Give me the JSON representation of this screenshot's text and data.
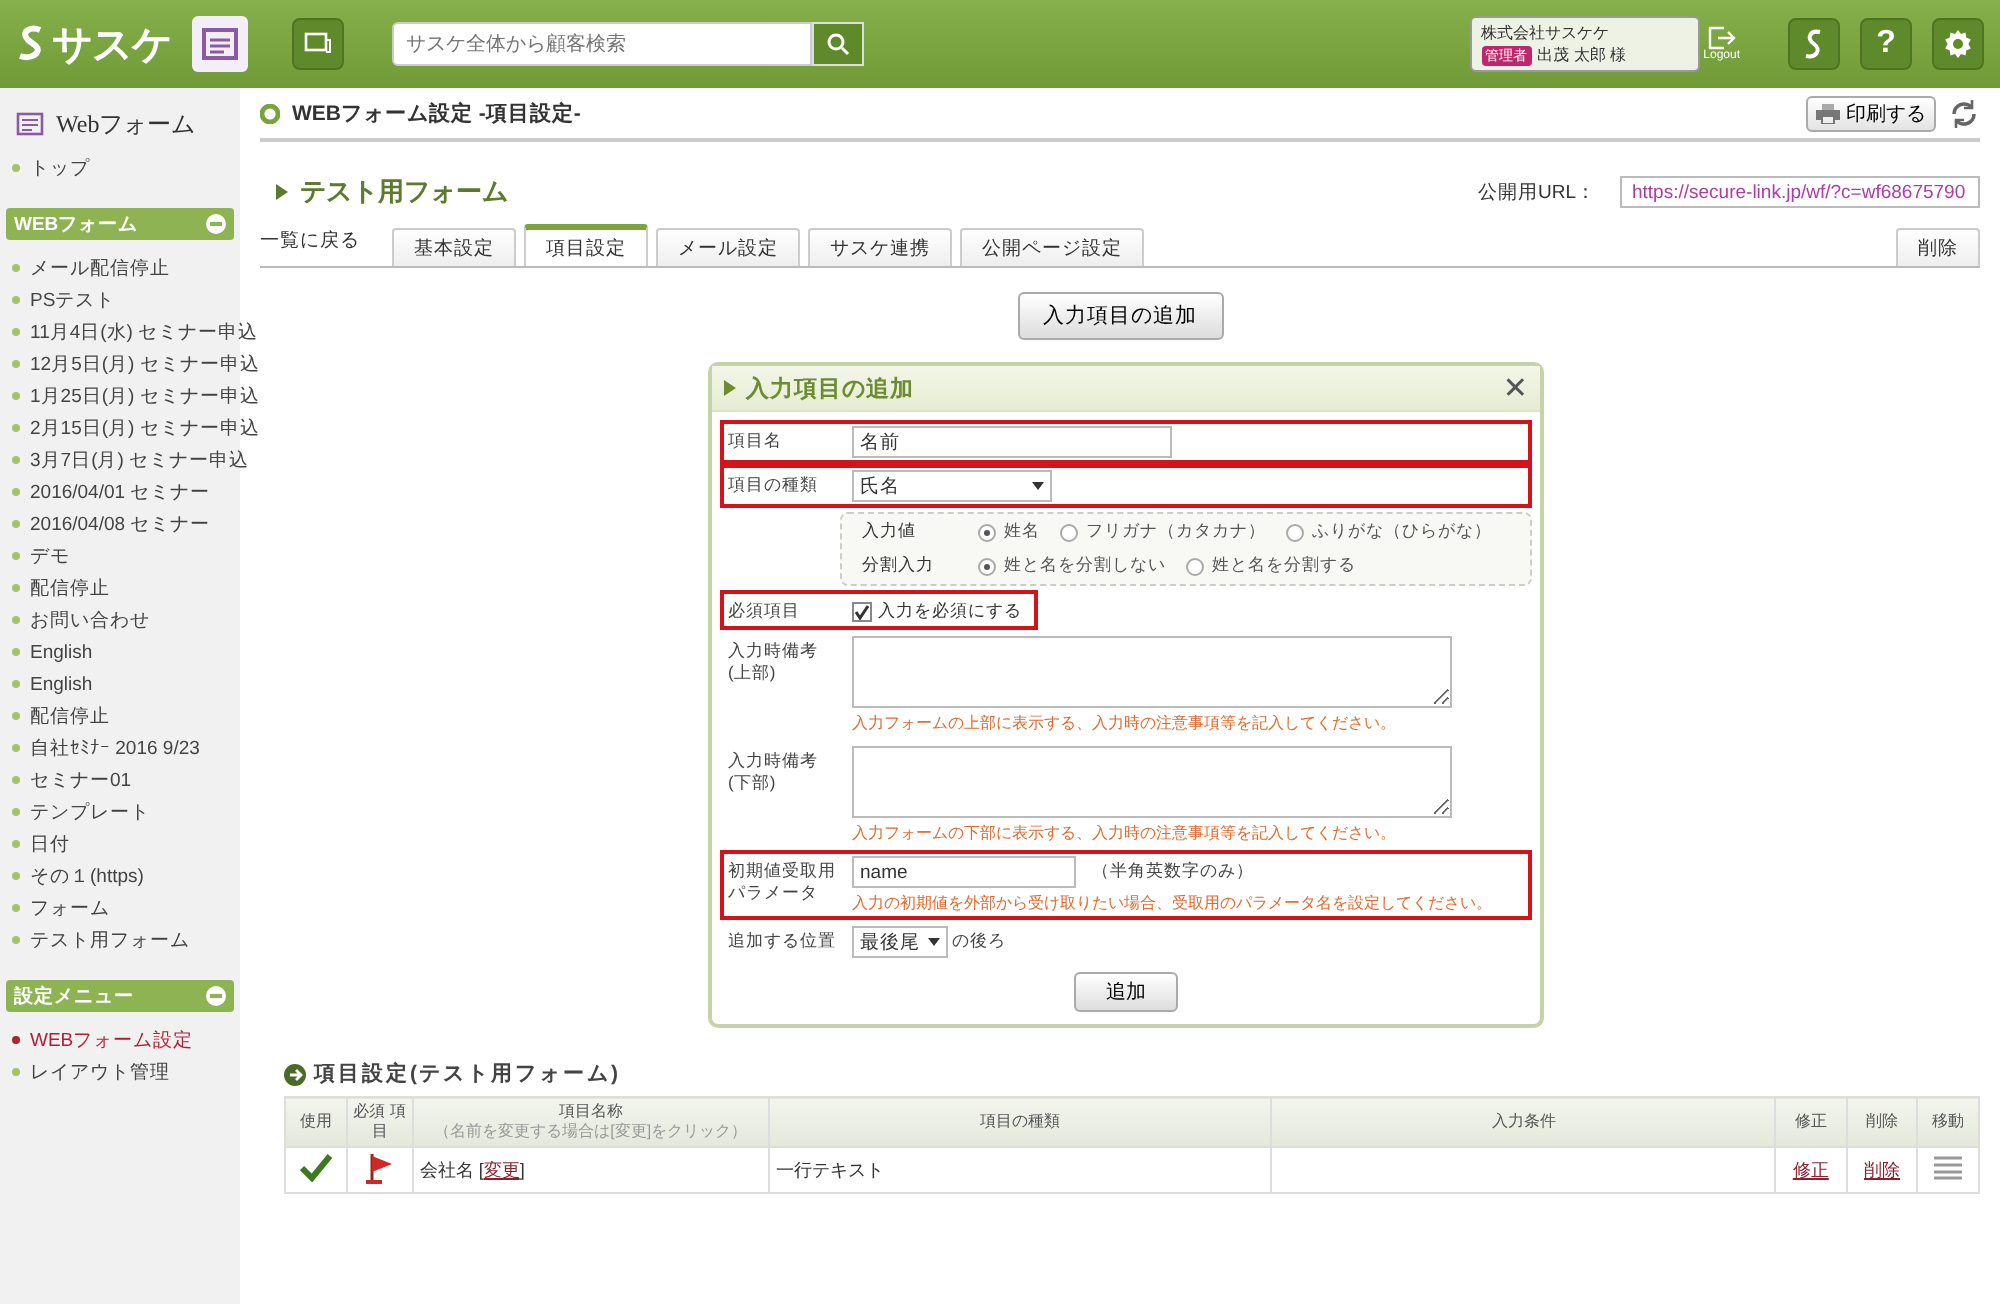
{
  "header": {
    "logo": "サスケ",
    "search_placeholder": "サスケ全体から顧客検索",
    "company": "株式会社サスケケ",
    "role_badge": "管理者",
    "user": "出茂 太郎 様",
    "logout": "Logout",
    "help": "?"
  },
  "sidebar": {
    "title": "Webフォーム",
    "top_link": "トップ",
    "sections": [
      {
        "title": "WEBフォーム",
        "items": [
          {
            "label": "メール配信停止",
            "selected": false
          },
          {
            "label": "PSテスト",
            "selected": false
          },
          {
            "label": "11月4日(水) セミナー申込",
            "selected": false
          },
          {
            "label": "12月5日(月) セミナー申込",
            "selected": false
          },
          {
            "label": "1月25日(月) セミナー申込",
            "selected": false
          },
          {
            "label": "2月15日(月) セミナー申込",
            "selected": false
          },
          {
            "label": "3月7日(月) セミナー申込",
            "selected": false
          },
          {
            "label": "2016/04/01 セミナー",
            "selected": false
          },
          {
            "label": "2016/04/08 セミナー",
            "selected": false
          },
          {
            "label": "デモ",
            "selected": false
          },
          {
            "label": "配信停止",
            "selected": false
          },
          {
            "label": "お問い合わせ",
            "selected": false
          },
          {
            "label": "English",
            "selected": false
          },
          {
            "label": "English",
            "selected": false
          },
          {
            "label": "配信停止",
            "selected": false
          },
          {
            "label": "自社ｾﾐﾅｰ 2016 9/23",
            "selected": false
          },
          {
            "label": "セミナー01",
            "selected": false
          },
          {
            "label": "テンプレート",
            "selected": false
          },
          {
            "label": "日付",
            "selected": false
          },
          {
            "label": "その１(https)",
            "selected": false
          },
          {
            "label": "フォーム",
            "selected": false
          },
          {
            "label": "テスト用フォーム",
            "selected": false
          }
        ]
      },
      {
        "title": "設定メニュー",
        "items": [
          {
            "label": "WEBフォーム設定",
            "selected": true
          },
          {
            "label": "レイアウト管理",
            "selected": false
          }
        ]
      }
    ]
  },
  "main": {
    "page_title": "WEBフォーム設定 -項目設定-",
    "print_button": "印刷する",
    "form_title": "テスト用フォーム",
    "url_label": "公開用URL：",
    "url_value": "https://secure-link.jp/wf/?c=wf68675790",
    "back_link": "一覧に戻る",
    "tabs": [
      {
        "label": "基本設定",
        "selected": false
      },
      {
        "label": "項目設定",
        "selected": true
      },
      {
        "label": "メール設定",
        "selected": false
      },
      {
        "label": "サスケ連携",
        "selected": false
      },
      {
        "label": "公開ページ設定",
        "selected": false
      }
    ],
    "delete_tab": "削除",
    "add_button": "入力項目の追加"
  },
  "dialog": {
    "title": "入力項目の追加",
    "fields": [
      {
        "kind": "text",
        "label": "項目名",
        "value": "名前",
        "highlighted": true
      },
      {
        "kind": "select",
        "label": "項目の種類",
        "value": "氏名",
        "highlighted": true
      },
      {
        "kind": "radios",
        "groups": [
          {
            "label": "入力値",
            "options": [
              {
                "label": "姓名",
                "selected": true
              },
              {
                "label": "フリガナ（カタカナ）",
                "selected": false
              },
              {
                "label": "ふりがな（ひらがな）",
                "selected": false
              }
            ]
          },
          {
            "label": "分割入力",
            "options": [
              {
                "label": "姓と名を分割しない",
                "selected": true
              },
              {
                "label": "姓と名を分割する",
                "selected": false
              }
            ]
          }
        ]
      },
      {
        "kind": "checkbox",
        "label": "必須項目",
        "option": "入力を必須にする",
        "checked": true,
        "highlighted": true
      },
      {
        "kind": "textarea",
        "label_lines": [
          "入力時備考",
          "(上部)"
        ],
        "hint": "入力フォームの上部に表示する、入力時の注意事項等を記入してください。",
        "highlighted": false
      },
      {
        "kind": "textarea",
        "label_lines": [
          "入力時備考",
          "(下部)"
        ],
        "hint": "入力フォームの下部に表示する、入力時の注意事項等を記入してください。",
        "highlighted": false
      },
      {
        "kind": "param",
        "label_lines": [
          "初期値受取用",
          "パラメータ"
        ],
        "value": "name",
        "note": "（半角英数字のみ）",
        "hint": "入力の初期値を外部から受け取りたい場合、受取用のパラメータ名を設定してください。",
        "highlighted": true
      },
      {
        "kind": "position",
        "label": "追加する位置",
        "value": "最後尾",
        "suffix": "の後ろ"
      }
    ],
    "submit": "追加",
    "close": "✕"
  },
  "table": {
    "title": "項目設定(テスト用フォーム)",
    "columns": [
      {
        "label": "使用"
      },
      {
        "label": "必須 項目"
      },
      {
        "label": "項目名称",
        "sub": "（名前を変更する場合は[変更]をクリック）"
      },
      {
        "label": "項目の種類"
      },
      {
        "label": "入力条件"
      },
      {
        "label": "修正"
      },
      {
        "label": "削除"
      },
      {
        "label": "移動"
      }
    ],
    "rows": [
      {
        "used": true,
        "required": true,
        "name": "会社名",
        "link_open": "[",
        "change_link": "変更",
        "link_close": "]",
        "type": "一行テキスト",
        "edit": "修正",
        "delete": "削除"
      }
    ]
  }
}
